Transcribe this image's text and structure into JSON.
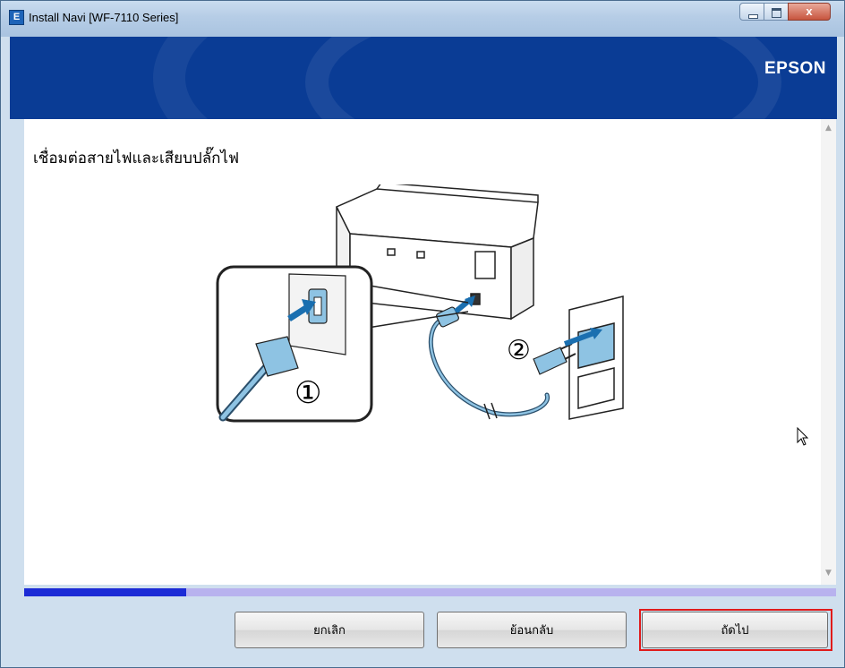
{
  "window": {
    "title": "Install Navi [WF-7110 Series]",
    "app_icon_letter": "E",
    "controls": {
      "close_glyph": "x"
    }
  },
  "header": {
    "brand": "EPSON",
    "color": "#0a3c95"
  },
  "main": {
    "title": "เชื่อมต่อสายไฟและเสียบปลั๊กไฟ",
    "illustration": {
      "step1_label": "①",
      "step2_label": "②"
    }
  },
  "progress": {
    "fraction": 0.2,
    "fill_color": "#1c2bd6",
    "track_color": "#b8b2ee"
  },
  "buttons": {
    "cancel_label": "ยกเลิก",
    "back_label": "ย้อนกลับ",
    "next_label": "ถัดไป"
  },
  "highlight_color": "#e01b1b",
  "icons": [
    "app-icon",
    "minimize-icon",
    "maximize-icon",
    "close-icon",
    "scroll-up-icon",
    "scroll-down-icon",
    "cursor-icon"
  ]
}
